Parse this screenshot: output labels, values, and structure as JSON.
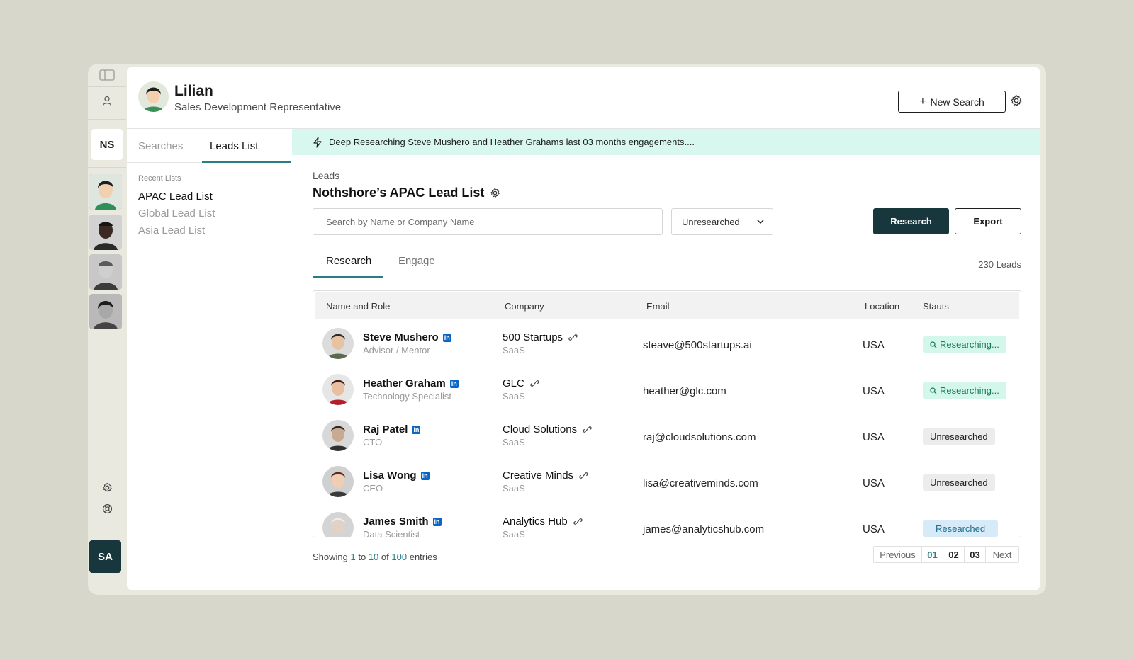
{
  "colors": {
    "accent": "#2a7d86",
    "dark_button": "#17373c",
    "banner_bg": "#d8f8ef",
    "researching_bg": "#d3f7ea",
    "researching_text": "#1a7a5a",
    "unresearched_bg": "#ececec",
    "researched_bg": "#d6ebf7",
    "researched_text": "#1f6e8f",
    "linkedin": "#0a66c2"
  },
  "rail": {
    "workspace_badge": "NS",
    "user_badge": "SA",
    "icons": [
      "sidebar-toggle-icon",
      "user-icon",
      "gear-icon",
      "support-icon"
    ]
  },
  "header": {
    "name": "Lilian",
    "role": "Sales Development Representative",
    "new_search_label": "New Search"
  },
  "left_panel": {
    "tabs": [
      "Searches",
      "Leads List"
    ],
    "active_tab": "Leads List",
    "recent_title": "Recent Lists",
    "lists": [
      "APAC Lead List",
      "Global Lead List",
      "Asia Lead List"
    ]
  },
  "banner": {
    "text": "Deep Researching Steve Mushero and Heather Grahams last 03 months engagements...."
  },
  "main": {
    "crumb": "Leads",
    "title": "Nothshore’s APAC Lead List",
    "search_placeholder": "Search by Name or Company Name",
    "filter_value": "Unresearched",
    "research_button": "Research",
    "export_button": "Export",
    "tabs": [
      "Research",
      "Engage"
    ],
    "lead_count": "230 Leads"
  },
  "table": {
    "columns": [
      "Name and Role",
      "Company",
      "Email",
      "Location",
      "Stauts"
    ],
    "rows": [
      {
        "name": "Steve Mushero",
        "role": "Advisor / Mentor",
        "company": "500 Startups",
        "industry": "SaaS",
        "email": "steave@500startups.ai",
        "location": "USA",
        "status": "Researching...",
        "status_type": "researching"
      },
      {
        "name": "Heather Graham",
        "role": "Technology Specialist",
        "company": "GLC",
        "industry": "SaaS",
        "email": "heather@glc.com",
        "location": "USA",
        "status": "Researching...",
        "status_type": "researching"
      },
      {
        "name": "Raj Patel",
        "role": "CTO",
        "company": "Cloud Solutions",
        "industry": "SaaS",
        "email": "raj@cloudsolutions.com",
        "location": "USA",
        "status": "Unresearched",
        "status_type": "unresearched"
      },
      {
        "name": "Lisa Wong",
        "role": "CEO",
        "company": "Creative Minds",
        "industry": "SaaS",
        "email": "lisa@creativeminds.com",
        "location": "USA",
        "status": "Unresearched",
        "status_type": "unresearched"
      },
      {
        "name": "James Smith",
        "role": "Data Scientist",
        "company": "Analytics Hub",
        "industry": "SaaS",
        "email": "james@analyticshub.com",
        "location": "USA",
        "status": "Researched",
        "status_type": "researched"
      }
    ]
  },
  "pagination": {
    "showing_prefix": "Showing",
    "from": "1",
    "to_word": "to",
    "to": "10",
    "of_word": "of",
    "total": "100",
    "entries_word": "entries",
    "previous": "Previous",
    "pages": [
      "01",
      "02",
      "03"
    ],
    "next": "Next"
  }
}
